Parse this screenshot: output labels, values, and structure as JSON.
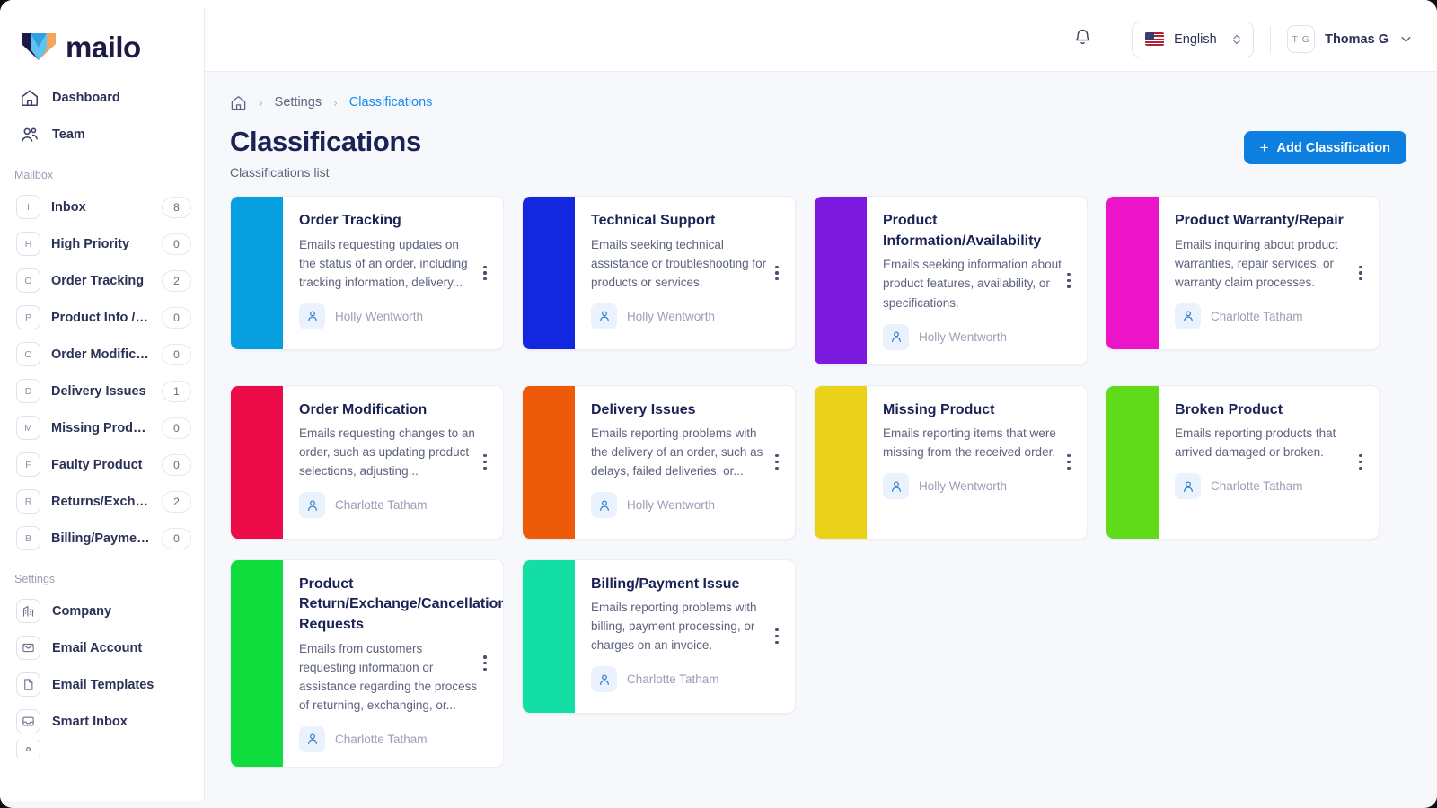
{
  "brand": {
    "name": "mailo"
  },
  "sidebar": {
    "primary": [
      {
        "label": "Dashboard",
        "icon": "home-icon"
      },
      {
        "label": "Team",
        "icon": "users-icon"
      }
    ],
    "mailbox_label": "Mailbox",
    "mailbox": [
      {
        "letter": "I",
        "label": "Inbox",
        "count": "8"
      },
      {
        "letter": "H",
        "label": "High Priority",
        "count": "0"
      },
      {
        "letter": "O",
        "label": "Order Tracking",
        "count": "2"
      },
      {
        "letter": "P",
        "label": "Product Info / A...",
        "count": "0"
      },
      {
        "letter": "O",
        "label": "Order Modifica...",
        "count": "0"
      },
      {
        "letter": "D",
        "label": "Delivery Issues",
        "count": "1"
      },
      {
        "letter": "M",
        "label": "Missing Product",
        "count": "0"
      },
      {
        "letter": "F",
        "label": "Faulty Product",
        "count": "0"
      },
      {
        "letter": "R",
        "label": "Returns/Exchan...",
        "count": "2"
      },
      {
        "letter": "B",
        "label": "Billing/Paymen...",
        "count": "0"
      }
    ],
    "settings_label": "Settings",
    "settings": [
      {
        "label": "Company",
        "icon": "building-icon"
      },
      {
        "label": "Email Account",
        "icon": "envelope-icon"
      },
      {
        "label": "Email Templates",
        "icon": "document-icon"
      },
      {
        "label": "Smart Inbox",
        "icon": "inbox-icon"
      }
    ]
  },
  "header": {
    "notifications_icon": "bell-icon",
    "language": {
      "value": "English",
      "flag": "us-flag"
    },
    "user": {
      "initials": "T G",
      "name": "Thomas G"
    }
  },
  "breadcrumb": {
    "home_icon": "home-icon",
    "items": [
      {
        "label": "Settings",
        "active": false
      },
      {
        "label": "Classifications",
        "active": true
      }
    ]
  },
  "page": {
    "title": "Classifications",
    "subtitle": "Classifications list",
    "add_button": "Add Classification",
    "accent_color": "#0d7fe0"
  },
  "classifications": [
    {
      "title": "Order Tracking",
      "description": "Emails requesting updates on the status of an order, including tracking information, delivery...",
      "owner": "Holly Wentworth",
      "color": "#06a0e0"
    },
    {
      "title": "Technical Support",
      "description": "Emails seeking technical assistance or troubleshooting for products or services.",
      "owner": "Holly Wentworth",
      "color": "#1427e0"
    },
    {
      "title": "Product Information/Availability",
      "description": "Emails seeking information about product features, availability, or specifications.",
      "owner": "Holly Wentworth",
      "color": "#7d1ae0"
    },
    {
      "title": "Product Warranty/Repair",
      "description": "Emails inquiring about product warranties, repair services, or warranty claim processes.",
      "owner": "Charlotte Tatham",
      "color": "#ec14c8"
    },
    {
      "title": "Order Modification",
      "description": "Emails requesting changes to an order, such as updating product selections, adjusting...",
      "owner": "Charlotte Tatham",
      "color": "#ed0a48"
    },
    {
      "title": "Delivery Issues",
      "description": "Emails reporting problems with the delivery of an order, such as delays, failed deliveries, or...",
      "owner": "Holly Wentworth",
      "color": "#ed5a0a"
    },
    {
      "title": "Missing Product",
      "description": "Emails reporting items that were missing from the received order.",
      "owner": "Holly Wentworth",
      "color": "#ebd21a"
    },
    {
      "title": "Broken Product",
      "description": "Emails reporting products that arrived damaged or broken.",
      "owner": "Charlotte Tatham",
      "color": "#5fdb19"
    },
    {
      "title": "Product Return/Exchange/Cancellation Requests",
      "description": "Emails from customers requesting information or assistance regarding the process of returning, exchanging, or...",
      "owner": "Charlotte Tatham",
      "color": "#10dd3d"
    },
    {
      "title": "Billing/Payment Issue",
      "description": "Emails reporting problems with billing, payment processing, or charges on an invoice.",
      "owner": "Charlotte Tatham",
      "color": "#13dfa5"
    }
  ]
}
